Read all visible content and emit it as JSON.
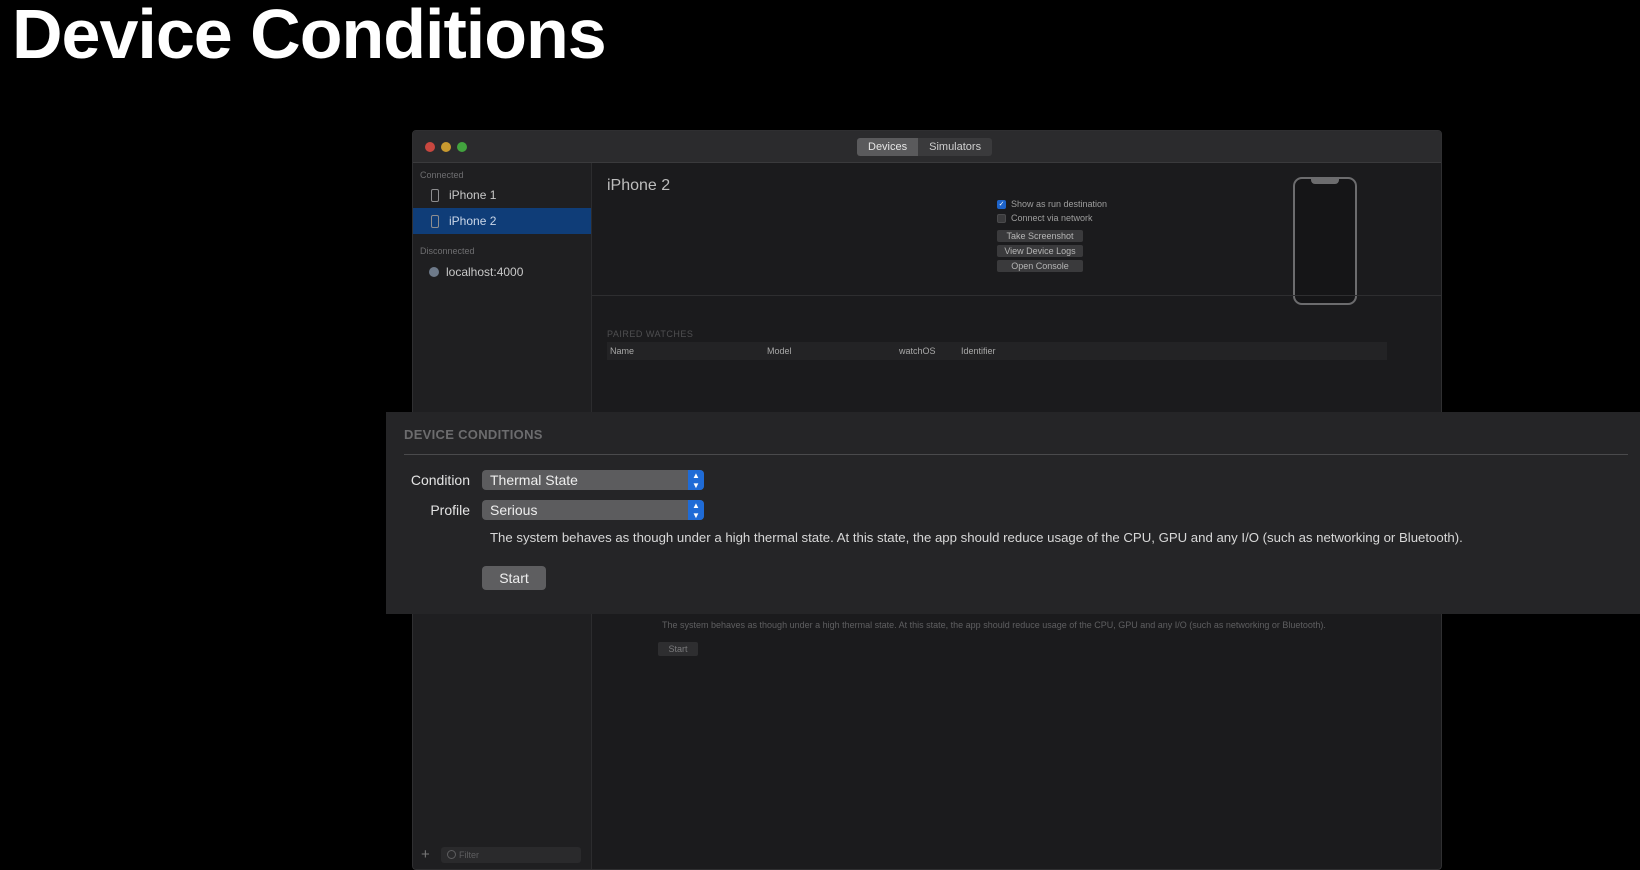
{
  "slide": {
    "title": "Device Conditions"
  },
  "window": {
    "tabs": [
      "Devices",
      "Simulators"
    ],
    "sidebar": {
      "connected_label": "Connected",
      "connected": [
        {
          "name": "iPhone 1",
          "selected": false
        },
        {
          "name": "iPhone 2",
          "selected": true
        }
      ],
      "disconnected_label": "Disconnected",
      "disconnected": [
        {
          "name": "localhost:4000"
        }
      ],
      "add_icon": "+",
      "filter_placeholder": "Filter"
    },
    "detail": {
      "device_name": "iPhone 2",
      "options": [
        {
          "label": "Show as run destination",
          "checked": true
        },
        {
          "label": "Connect via network",
          "checked": false
        }
      ],
      "buttons": [
        "Take Screenshot",
        "View Device Logs",
        "Open Console"
      ],
      "paired_watches_label": "PAIRED WATCHES",
      "columns": [
        "Name",
        "Model",
        "watchOS",
        "Identifier"
      ],
      "background_description": "The system behaves as though under a high thermal state. At this state, the app should reduce usage of the CPU, GPU and any I/O (such as networking or Bluetooth).",
      "background_start": "Start"
    }
  },
  "device_conditions": {
    "header": "DEVICE CONDITIONS",
    "condition_label": "Condition",
    "condition_value": "Thermal State",
    "profile_label": "Profile",
    "profile_value": "Serious",
    "description": "The system behaves as though under a high thermal state. At this state, the app should reduce usage of the CPU, GPU and any I/O (such as networking or Bluetooth).",
    "start_label": "Start",
    "accent_color": "#1f6bd6"
  }
}
